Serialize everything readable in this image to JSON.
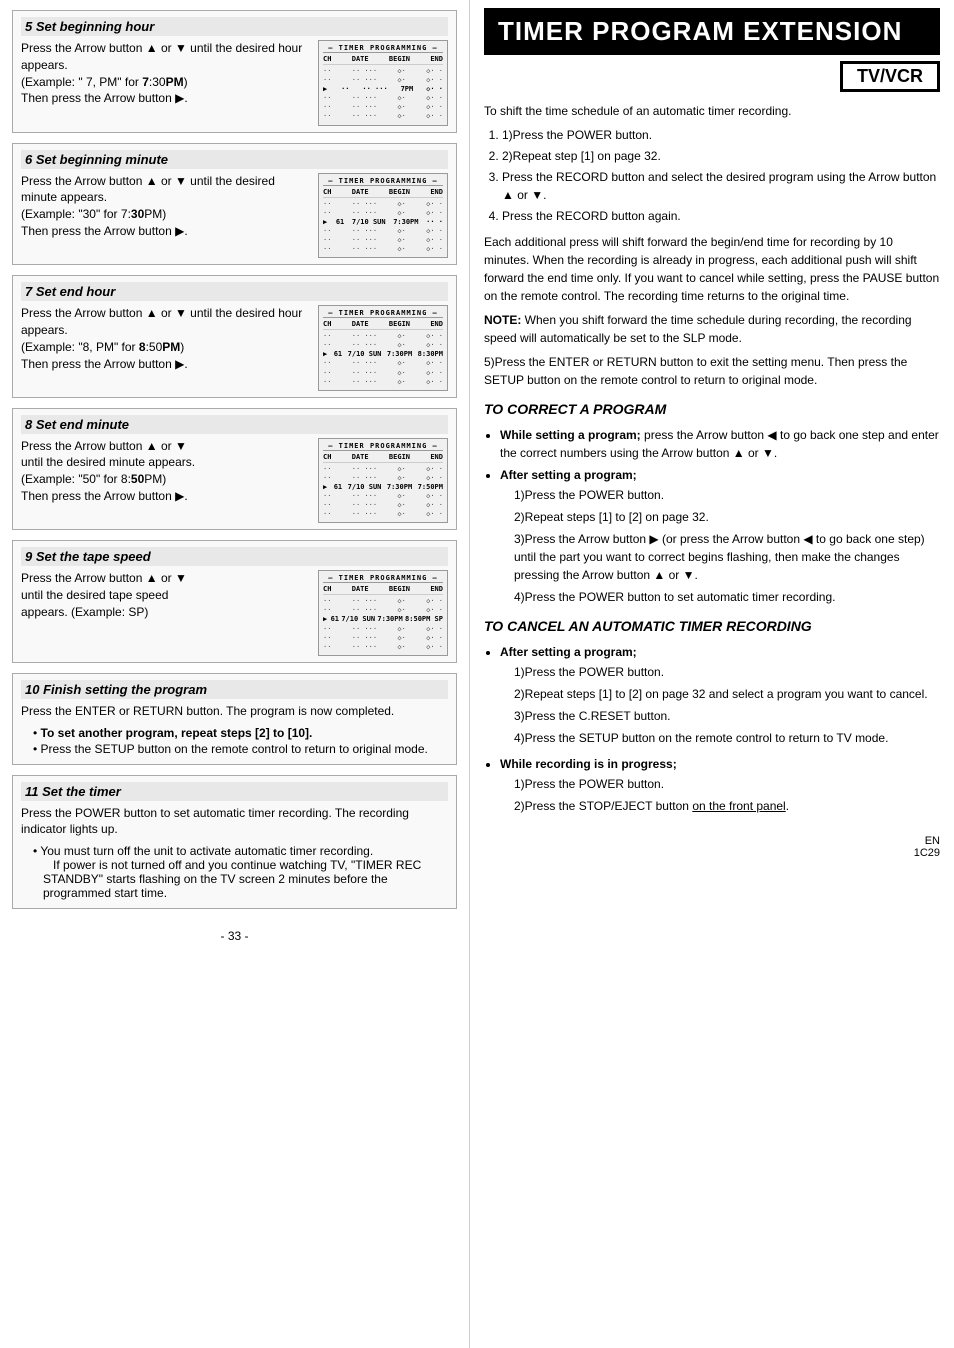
{
  "left": {
    "steps": [
      {
        "id": "step5",
        "header": "5  Set beginning hour",
        "text": "Press the Arrow button ▲ or ▼ until the desired hour appears.\n(Example: “ 7, PM” for 7:30PM)\nThen press the Arrow button ▶.",
        "display": {
          "header": "– TIMER PROGRAMMING –",
          "cols": [
            "CH",
            "DATE",
            "BEGIN",
            "END"
          ],
          "rows": [
            {
              "ch": "··",
              "date": "··· ···",
              "begin": "◇·",
              "end": "◇· ·"
            },
            {
              "ch": "··",
              "date": "··· ···",
              "begin": "◇·",
              "end": "◇· ·"
            },
            {
              "ch": "··",
              "date": "··· ···",
              "begin": "7PM",
              "end": "◇· ·",
              "selected": true
            },
            {
              "ch": "··",
              "date": "··· ···",
              "begin": "◇·",
              "end": "◇· ·"
            },
            {
              "ch": "··",
              "date": "··· ···",
              "begin": "◇·",
              "end": "◇· ·"
            },
            {
              "ch": "··",
              "date": "··· ···",
              "begin": "◇·",
              "end": "◇· ·"
            }
          ]
        }
      },
      {
        "id": "step6",
        "header": "6  Set beginning minute",
        "text": "Press the Arrow button ▲ or ▼ until the desired minute appears.\n(Example: “30” for 7:30PM)\nThen press the Arrow button ▶.",
        "display": {
          "header": "– TIMER PROGRAMMING –",
          "cols": [
            "CH",
            "DATE",
            "BEGIN",
            "END"
          ],
          "selected_row": "61  7/10 SUN– 7:30PM–  ··  ·"
        }
      },
      {
        "id": "step7",
        "header": "7  Set end hour",
        "text": "Press the Arrow button ▲ or ▼ until the desired hour appears.\n(Example: “8, PM” for 8:50PM)\nThen press the Arrow button ▶.",
        "display": {
          "header": "– TIMER PROGRAMMING –",
          "cols": [
            "CH",
            "DATE",
            "BEGIN",
            "END"
          ],
          "selected_row": "61  7/10 SUN  7:30PM  8:30PM"
        }
      },
      {
        "id": "step8",
        "header": "8  Set end minute",
        "text": "Press the Arrow button ▲ or ▼ until the desired minute appears.\n(Example: “50” for 8:50PM)\nThen press the Arrow button ▶.",
        "display": {
          "header": "– TIMER PROGRAMMING –",
          "cols": [
            "CH",
            "DATE",
            "BEGIN",
            "END"
          ],
          "selected_row": "61  7/10 SUN  7:30PM  7:50PM"
        }
      },
      {
        "id": "step9",
        "header": "9  Set the tape speed",
        "text": "Press the Arrow button ▲ or ▼ until the desired tape speed appears. (Example: SP)",
        "display": {
          "header": "– TIMER PROGRAMMING –",
          "cols": [
            "CH",
            "DATE",
            "BEGIN",
            "END"
          ],
          "selected_row": "61  7/10 SUN  7:30PM  8:50PM SP"
        }
      }
    ],
    "step10": {
      "header": "10  Finish setting the program",
      "text": "Press the ENTER or RETURN button. The program is now completed.",
      "bullets": [
        "To set another program, repeat steps [2] to [10].",
        "Press the SETUP button on the remote control to return to original mode."
      ]
    },
    "step11": {
      "header": "11  Set the timer",
      "text": "Press the POWER button to set automatic timer recording. The recording indicator lights up.",
      "bullets": [
        "You must turn off the unit to activate automatic timer recording.\nIf power is not turned off and you continue watching TV, \"TIMER REC STANDBY\" starts flashing on the TV screen 2 minutes before the programmed start time."
      ]
    },
    "page_num": "- 33 -",
    "lang": "EN",
    "model": "1C29"
  },
  "right": {
    "title": "TIMER PROGRAM EXTENSION",
    "subtitle": "TV/VCR",
    "intro": "To shift the time schedule of an automatic timer recording.",
    "steps": [
      "1)Press the POWER button.",
      "2)Repeat step [1] on page 32.",
      "3)Press the RECORD button and select the desired program using the Arrow button ▲ or ▼.",
      "4)Press the RECORD button again."
    ],
    "step4_detail": "Each additional press will shift forward the begin/end time for recording by 10 minutes. When the recording is already in progress, each additional push will shift forward the end time only. If you want to cancel while setting, press the PAUSE button on the remote control. The recording time returns to the original time.",
    "note": "NOTE: When you shift forward the time schedule during recording, the recording speed will automatically be set to the SLP mode.",
    "step5": "5)Press the ENTER or RETURN button to exit the setting menu. Then press the SETUP button on the remote control to return to original mode.",
    "correct_title": "TO CORRECT A PROGRAM",
    "correct_bullets": [
      {
        "bold": "While setting a program;",
        "text": " press the Arrow button ◀ to go back one step and enter the correct numbers using the Arrow button ▲ or ▼."
      },
      {
        "bold": "After setting a program;",
        "sub": [
          "1)Press the POWER button.",
          "2)Repeat steps [1] to [2] on page 32.",
          "3)Press the Arrow button ▶ (or press the Arrow button ◀ to go back one step) until the part you want to correct begins flashing, then make the changes pressing the Arrow button ▲ or ▼.",
          "4)Press the POWER button to set automatic timer recording."
        ]
      }
    ],
    "cancel_title": "TO CANCEL AN AUTOMATIC TIMER RECORDING",
    "cancel_bullets": [
      {
        "bold": "After setting a program;",
        "sub": [
          "1)Press the POWER button.",
          "2)Repeat steps [1] to [2] on page 32 and select a program you want to cancel.",
          "3)Press the C.RESET button.",
          "4)Press the SETUP button on the remote control to return to TV mode."
        ]
      },
      {
        "bold": "While recording is in progress;",
        "sub": [
          "1)Press the POWER button.",
          "2)Press the STOP/EJECT button on the front panel."
        ],
        "underline_item": 1
      }
    ]
  }
}
